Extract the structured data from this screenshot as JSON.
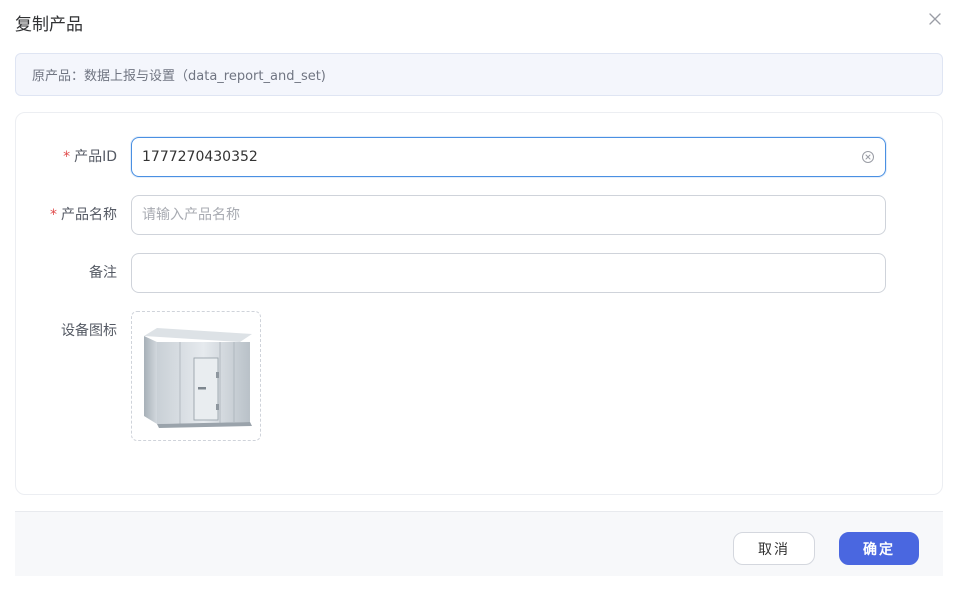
{
  "dialog": {
    "title": "复制产品",
    "close_icon": "close-icon"
  },
  "source_banner": {
    "text": "原产品：数据上报与设置（data_report_and_set)"
  },
  "form": {
    "product_id": {
      "label": "产品ID",
      "required_mark": "*",
      "value": "1777270430352",
      "clear_icon": "circle-x-icon"
    },
    "product_name": {
      "label": "产品名称",
      "required_mark": "*",
      "value": "",
      "placeholder": "请输入产品名称"
    },
    "remark": {
      "label": "备注",
      "value": "",
      "placeholder": ""
    },
    "device_icon": {
      "label": "设备图标",
      "image": "cold-room-image"
    }
  },
  "footer": {
    "cancel_label": "取消",
    "confirm_label": "确定"
  },
  "colors": {
    "primary": "#4a67e0",
    "focus_border": "#4a90e2",
    "required": "#e04a4a",
    "banner_bg": "#f4f6fc"
  }
}
